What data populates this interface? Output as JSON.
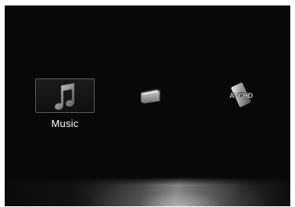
{
  "menu": {
    "items": [
      {
        "label": "Music",
        "icon": "music-note-icon",
        "selected": true
      },
      {
        "label": "",
        "icon": "photo-stack-icon",
        "selected": false
      },
      {
        "label": "",
        "icon": "avchd-icon",
        "selected": false
      }
    ],
    "selected_label": "Music"
  },
  "avchd_icon_text": "AVCHD",
  "colors": {
    "background": "#080808",
    "selection_border": "#5a5a5a",
    "label": "#ffffff"
  }
}
